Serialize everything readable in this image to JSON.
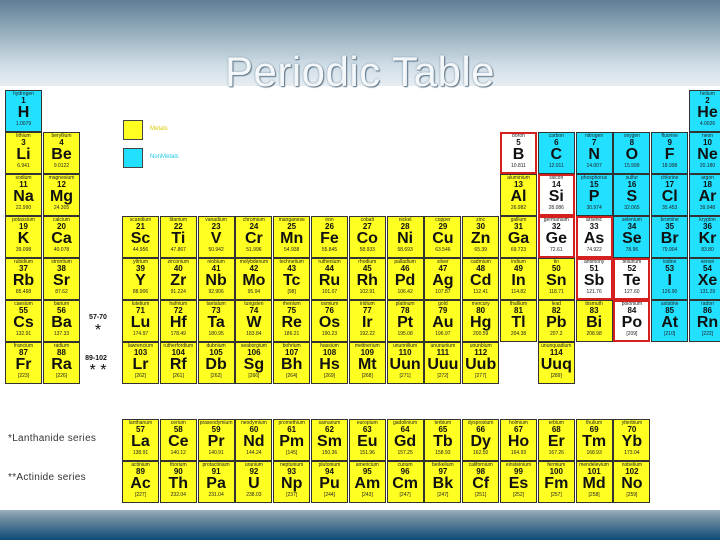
{
  "title": "Periodic Table",
  "legend": {
    "metals_label": "Metals",
    "nonmetals_label": "NonMetals",
    "metal_color": "#ffff22",
    "nonmetal_color": "#22e0ff"
  },
  "series": {
    "lanthanide_label": "*Lanthanide series",
    "actinide_label": "**Actinide series",
    "ref_57_70": "57-70",
    "ref_89_102": "89-102",
    "star_single": "*",
    "star_double": "* *"
  },
  "elements": [
    {
      "c": 1,
      "r": 1,
      "n": "hydrogen",
      "z": "1",
      "s": "H",
      "w": "1.0079",
      "k": "nonmetal"
    },
    {
      "c": 18,
      "r": 1,
      "n": "helium",
      "z": "2",
      "s": "He",
      "w": "4.0026",
      "k": "nonmetal"
    },
    {
      "c": 1,
      "r": 2,
      "n": "lithium",
      "z": "3",
      "s": "Li",
      "w": "6.941",
      "k": "metal"
    },
    {
      "c": 2,
      "r": 2,
      "n": "beryllium",
      "z": "4",
      "s": "Be",
      "w": "9.0122",
      "k": "metal"
    },
    {
      "c": 13,
      "r": 2,
      "n": "boron",
      "z": "5",
      "s": "B",
      "w": "10.811",
      "k": "plain",
      "h": true
    },
    {
      "c": 14,
      "r": 2,
      "n": "carbon",
      "z": "6",
      "s": "C",
      "w": "12.011",
      "k": "nonmetal"
    },
    {
      "c": 15,
      "r": 2,
      "n": "nitrogen",
      "z": "7",
      "s": "N",
      "w": "14.007",
      "k": "nonmetal"
    },
    {
      "c": 16,
      "r": 2,
      "n": "oxygen",
      "z": "8",
      "s": "O",
      "w": "15.999",
      "k": "nonmetal"
    },
    {
      "c": 17,
      "r": 2,
      "n": "fluorine",
      "z": "9",
      "s": "F",
      "w": "18.998",
      "k": "nonmetal"
    },
    {
      "c": 18,
      "r": 2,
      "n": "neon",
      "z": "10",
      "s": "Ne",
      "w": "20.180",
      "k": "nonmetal"
    },
    {
      "c": 1,
      "r": 3,
      "n": "sodium",
      "z": "11",
      "s": "Na",
      "w": "22.990",
      "k": "metal"
    },
    {
      "c": 2,
      "r": 3,
      "n": "magnesium",
      "z": "12",
      "s": "Mg",
      "w": "24.305",
      "k": "metal"
    },
    {
      "c": 13,
      "r": 3,
      "n": "aluminium",
      "z": "13",
      "s": "Al",
      "w": "26.982",
      "k": "metal"
    },
    {
      "c": 14,
      "r": 3,
      "n": "silicon",
      "z": "14",
      "s": "Si",
      "w": "28.086",
      "k": "plain",
      "h": true
    },
    {
      "c": 15,
      "r": 3,
      "n": "phosphorus",
      "z": "15",
      "s": "P",
      "w": "30.974",
      "k": "nonmetal"
    },
    {
      "c": 16,
      "r": 3,
      "n": "sulfur",
      "z": "16",
      "s": "S",
      "w": "32.065",
      "k": "nonmetal"
    },
    {
      "c": 17,
      "r": 3,
      "n": "chlorine",
      "z": "17",
      "s": "Cl",
      "w": "35.453",
      "k": "nonmetal"
    },
    {
      "c": 18,
      "r": 3,
      "n": "argon",
      "z": "18",
      "s": "Ar",
      "w": "39.948",
      "k": "nonmetal"
    },
    {
      "c": 1,
      "r": 4,
      "n": "potassium",
      "z": "19",
      "s": "K",
      "w": "39.098",
      "k": "metal"
    },
    {
      "c": 2,
      "r": 4,
      "n": "calcium",
      "z": "20",
      "s": "Ca",
      "w": "40.078",
      "k": "metal"
    },
    {
      "c": 3,
      "r": 4,
      "n": "scandium",
      "z": "21",
      "s": "Sc",
      "w": "44.956",
      "k": "metal"
    },
    {
      "c": 4,
      "r": 4,
      "n": "titanium",
      "z": "22",
      "s": "Ti",
      "w": "47.867",
      "k": "metal"
    },
    {
      "c": 5,
      "r": 4,
      "n": "vanadium",
      "z": "23",
      "s": "V",
      "w": "50.942",
      "k": "metal"
    },
    {
      "c": 6,
      "r": 4,
      "n": "chromium",
      "z": "24",
      "s": "Cr",
      "w": "51.996",
      "k": "metal"
    },
    {
      "c": 7,
      "r": 4,
      "n": "manganese",
      "z": "25",
      "s": "Mn",
      "w": "54.938",
      "k": "metal"
    },
    {
      "c": 8,
      "r": 4,
      "n": "iron",
      "z": "26",
      "s": "Fe",
      "w": "55.845",
      "k": "metal"
    },
    {
      "c": 9,
      "r": 4,
      "n": "cobalt",
      "z": "27",
      "s": "Co",
      "w": "58.933",
      "k": "metal"
    },
    {
      "c": 10,
      "r": 4,
      "n": "nickel",
      "z": "28",
      "s": "Ni",
      "w": "58.693",
      "k": "metal"
    },
    {
      "c": 11,
      "r": 4,
      "n": "copper",
      "z": "29",
      "s": "Cu",
      "w": "63.546",
      "k": "metal"
    },
    {
      "c": 12,
      "r": 4,
      "n": "zinc",
      "z": "30",
      "s": "Zn",
      "w": "65.39",
      "k": "metal"
    },
    {
      "c": 13,
      "r": 4,
      "n": "gallium",
      "z": "31",
      "s": "Ga",
      "w": "69.723",
      "k": "metal"
    },
    {
      "c": 14,
      "r": 4,
      "n": "germanium",
      "z": "32",
      "s": "Ge",
      "w": "72.61",
      "k": "plain",
      "h": true
    },
    {
      "c": 15,
      "r": 4,
      "n": "arsenic",
      "z": "33",
      "s": "As",
      "w": "74.922",
      "k": "plain",
      "h": true
    },
    {
      "c": 16,
      "r": 4,
      "n": "selenium",
      "z": "34",
      "s": "Se",
      "w": "78.96",
      "k": "nonmetal"
    },
    {
      "c": 17,
      "r": 4,
      "n": "bromine",
      "z": "35",
      "s": "Br",
      "w": "79.904",
      "k": "nonmetal"
    },
    {
      "c": 18,
      "r": 4,
      "n": "krypton",
      "z": "36",
      "s": "Kr",
      "w": "83.80",
      "k": "nonmetal"
    },
    {
      "c": 1,
      "r": 5,
      "n": "rubidium",
      "z": "37",
      "s": "Rb",
      "w": "85.468",
      "k": "metal"
    },
    {
      "c": 2,
      "r": 5,
      "n": "strontium",
      "z": "38",
      "s": "Sr",
      "w": "87.62",
      "k": "metal"
    },
    {
      "c": 3,
      "r": 5,
      "n": "yttrium",
      "z": "39",
      "s": "Y",
      "w": "88.906",
      "k": "metal"
    },
    {
      "c": 4,
      "r": 5,
      "n": "zirconium",
      "z": "40",
      "s": "Zr",
      "w": "91.224",
      "k": "metal"
    },
    {
      "c": 5,
      "r": 5,
      "n": "niobium",
      "z": "41",
      "s": "Nb",
      "w": "92.906",
      "k": "metal"
    },
    {
      "c": 6,
      "r": 5,
      "n": "molybdenum",
      "z": "42",
      "s": "Mo",
      "w": "95.94",
      "k": "metal"
    },
    {
      "c": 7,
      "r": 5,
      "n": "technetium",
      "z": "43",
      "s": "Tc",
      "w": "[98]",
      "k": "metal"
    },
    {
      "c": 8,
      "r": 5,
      "n": "ruthenium",
      "z": "44",
      "s": "Ru",
      "w": "101.07",
      "k": "metal"
    },
    {
      "c": 9,
      "r": 5,
      "n": "rhodium",
      "z": "45",
      "s": "Rh",
      "w": "102.91",
      "k": "metal"
    },
    {
      "c": 10,
      "r": 5,
      "n": "palladium",
      "z": "46",
      "s": "Pd",
      "w": "106.42",
      "k": "metal"
    },
    {
      "c": 11,
      "r": 5,
      "n": "silver",
      "z": "47",
      "s": "Ag",
      "w": "107.87",
      "k": "metal"
    },
    {
      "c": 12,
      "r": 5,
      "n": "cadmium",
      "z": "48",
      "s": "Cd",
      "w": "112.41",
      "k": "metal"
    },
    {
      "c": 13,
      "r": 5,
      "n": "indium",
      "z": "49",
      "s": "In",
      "w": "114.82",
      "k": "metal"
    },
    {
      "c": 14,
      "r": 5,
      "n": "tin",
      "z": "50",
      "s": "Sn",
      "w": "118.71",
      "k": "metal"
    },
    {
      "c": 15,
      "r": 5,
      "n": "antimony",
      "z": "51",
      "s": "Sb",
      "w": "121.76",
      "k": "plain",
      "h": true
    },
    {
      "c": 16,
      "r": 5,
      "n": "tellurium",
      "z": "52",
      "s": "Te",
      "w": "127.60",
      "k": "plain",
      "h": true
    },
    {
      "c": 17,
      "r": 5,
      "n": "iodine",
      "z": "53",
      "s": "I",
      "w": "126.90",
      "k": "nonmetal"
    },
    {
      "c": 18,
      "r": 5,
      "n": "xenon",
      "z": "54",
      "s": "Xe",
      "w": "131.29",
      "k": "nonmetal"
    },
    {
      "c": 1,
      "r": 6,
      "n": "caesium",
      "z": "55",
      "s": "Cs",
      "w": "132.91",
      "k": "metal"
    },
    {
      "c": 2,
      "r": 6,
      "n": "barium",
      "z": "56",
      "s": "Ba",
      "w": "137.33",
      "k": "metal"
    },
    {
      "c": 3,
      "r": 6,
      "n": "lutetium",
      "z": "71",
      "s": "Lu",
      "w": "174.97",
      "k": "metal"
    },
    {
      "c": 4,
      "r": 6,
      "n": "hafnium",
      "z": "72",
      "s": "Hf",
      "w": "178.49",
      "k": "metal"
    },
    {
      "c": 5,
      "r": 6,
      "n": "tantalum",
      "z": "73",
      "s": "Ta",
      "w": "180.95",
      "k": "metal"
    },
    {
      "c": 6,
      "r": 6,
      "n": "tungsten",
      "z": "74",
      "s": "W",
      "w": "183.84",
      "k": "metal"
    },
    {
      "c": 7,
      "r": 6,
      "n": "rhenium",
      "z": "75",
      "s": "Re",
      "w": "186.21",
      "k": "metal"
    },
    {
      "c": 8,
      "r": 6,
      "n": "osmium",
      "z": "76",
      "s": "Os",
      "w": "190.23",
      "k": "metal"
    },
    {
      "c": 9,
      "r": 6,
      "n": "iridium",
      "z": "77",
      "s": "Ir",
      "w": "192.22",
      "k": "metal"
    },
    {
      "c": 10,
      "r": 6,
      "n": "platinum",
      "z": "78",
      "s": "Pt",
      "w": "195.08",
      "k": "metal"
    },
    {
      "c": 11,
      "r": 6,
      "n": "gold",
      "z": "79",
      "s": "Au",
      "w": "196.97",
      "k": "metal"
    },
    {
      "c": 12,
      "r": 6,
      "n": "mercury",
      "z": "80",
      "s": "Hg",
      "w": "200.59",
      "k": "metal"
    },
    {
      "c": 13,
      "r": 6,
      "n": "thallium",
      "z": "81",
      "s": "Tl",
      "w": "204.38",
      "k": "metal"
    },
    {
      "c": 14,
      "r": 6,
      "n": "lead",
      "z": "82",
      "s": "Pb",
      "w": "207.2",
      "k": "metal"
    },
    {
      "c": 15,
      "r": 6,
      "n": "bismuth",
      "z": "83",
      "s": "Bi",
      "w": "208.98",
      "k": "metal"
    },
    {
      "c": 16,
      "r": 6,
      "n": "polonium",
      "z": "84",
      "s": "Po",
      "w": "[209]",
      "k": "plain",
      "h": true
    },
    {
      "c": 17,
      "r": 6,
      "n": "astatine",
      "z": "85",
      "s": "At",
      "w": "[210]",
      "k": "nonmetal"
    },
    {
      "c": 18,
      "r": 6,
      "n": "radon",
      "z": "86",
      "s": "Rn",
      "w": "[222]",
      "k": "nonmetal"
    },
    {
      "c": 1,
      "r": 7,
      "n": "francium",
      "z": "87",
      "s": "Fr",
      "w": "[223]",
      "k": "metal"
    },
    {
      "c": 2,
      "r": 7,
      "n": "radium",
      "z": "88",
      "s": "Ra",
      "w": "[226]",
      "k": "metal"
    },
    {
      "c": 3,
      "r": 7,
      "n": "lawrencium",
      "z": "103",
      "s": "Lr",
      "w": "[262]",
      "k": "metal"
    },
    {
      "c": 4,
      "r": 7,
      "n": "rutherfordium",
      "z": "104",
      "s": "Rf",
      "w": "[261]",
      "k": "metal"
    },
    {
      "c": 5,
      "r": 7,
      "n": "dubnium",
      "z": "105",
      "s": "Db",
      "w": "[262]",
      "k": "metal"
    },
    {
      "c": 6,
      "r": 7,
      "n": "seaborgium",
      "z": "106",
      "s": "Sg",
      "w": "[266]",
      "k": "metal"
    },
    {
      "c": 7,
      "r": 7,
      "n": "bohrium",
      "z": "107",
      "s": "Bh",
      "w": "[264]",
      "k": "metal"
    },
    {
      "c": 8,
      "r": 7,
      "n": "hassium",
      "z": "108",
      "s": "Hs",
      "w": "[269]",
      "k": "metal"
    },
    {
      "c": 9,
      "r": 7,
      "n": "meitnerium",
      "z": "109",
      "s": "Mt",
      "w": "[268]",
      "k": "metal"
    },
    {
      "c": 10,
      "r": 7,
      "n": "ununnilium",
      "z": "110",
      "s": "Uun",
      "w": "[271]",
      "k": "metal"
    },
    {
      "c": 11,
      "r": 7,
      "n": "unununium",
      "z": "111",
      "s": "Uuu",
      "w": "[272]",
      "k": "metal"
    },
    {
      "c": 12,
      "r": 7,
      "n": "ununbium",
      "z": "112",
      "s": "Uub",
      "w": "[277]",
      "k": "metal"
    },
    {
      "c": 14,
      "r": 7,
      "n": "ununquadium",
      "z": "114",
      "s": "Uuq",
      "w": "[289]",
      "k": "metal"
    },
    {
      "c": 3,
      "r": 9,
      "n": "lanthanum",
      "z": "57",
      "s": "La",
      "w": "138.91",
      "k": "metal"
    },
    {
      "c": 4,
      "r": 9,
      "n": "cerium",
      "z": "58",
      "s": "Ce",
      "w": "140.12",
      "k": "metal"
    },
    {
      "c": 5,
      "r": 9,
      "n": "praseodymium",
      "z": "59",
      "s": "Pr",
      "w": "140.91",
      "k": "metal"
    },
    {
      "c": 6,
      "r": 9,
      "n": "neodymium",
      "z": "60",
      "s": "Nd",
      "w": "144.24",
      "k": "metal"
    },
    {
      "c": 7,
      "r": 9,
      "n": "promethium",
      "z": "61",
      "s": "Pm",
      "w": "[145]",
      "k": "metal"
    },
    {
      "c": 8,
      "r": 9,
      "n": "samarium",
      "z": "62",
      "s": "Sm",
      "w": "150.36",
      "k": "metal"
    },
    {
      "c": 9,
      "r": 9,
      "n": "europium",
      "z": "63",
      "s": "Eu",
      "w": "151.96",
      "k": "metal"
    },
    {
      "c": 10,
      "r": 9,
      "n": "gadolinium",
      "z": "64",
      "s": "Gd",
      "w": "157.25",
      "k": "metal"
    },
    {
      "c": 11,
      "r": 9,
      "n": "terbium",
      "z": "65",
      "s": "Tb",
      "w": "158.93",
      "k": "metal"
    },
    {
      "c": 12,
      "r": 9,
      "n": "dysprosium",
      "z": "66",
      "s": "Dy",
      "w": "162.50",
      "k": "metal"
    },
    {
      "c": 13,
      "r": 9,
      "n": "holmium",
      "z": "67",
      "s": "Ho",
      "w": "164.93",
      "k": "metal"
    },
    {
      "c": 14,
      "r": 9,
      "n": "erbium",
      "z": "68",
      "s": "Er",
      "w": "167.26",
      "k": "metal"
    },
    {
      "c": 15,
      "r": 9,
      "n": "thulium",
      "z": "69",
      "s": "Tm",
      "w": "168.93",
      "k": "metal"
    },
    {
      "c": 16,
      "r": 9,
      "n": "ytterbium",
      "z": "70",
      "s": "Yb",
      "w": "173.04",
      "k": "metal"
    },
    {
      "c": 3,
      "r": 10,
      "n": "actinium",
      "z": "89",
      "s": "Ac",
      "w": "[227]",
      "k": "metal"
    },
    {
      "c": 4,
      "r": 10,
      "n": "thorium",
      "z": "90",
      "s": "Th",
      "w": "232.04",
      "k": "metal"
    },
    {
      "c": 5,
      "r": 10,
      "n": "protactinium",
      "z": "91",
      "s": "Pa",
      "w": "231.04",
      "k": "metal"
    },
    {
      "c": 6,
      "r": 10,
      "n": "uranium",
      "z": "92",
      "s": "U",
      "w": "238.03",
      "k": "metal"
    },
    {
      "c": 7,
      "r": 10,
      "n": "neptunium",
      "z": "93",
      "s": "Np",
      "w": "[237]",
      "k": "metal"
    },
    {
      "c": 8,
      "r": 10,
      "n": "plutonium",
      "z": "94",
      "s": "Pu",
      "w": "[244]",
      "k": "metal"
    },
    {
      "c": 9,
      "r": 10,
      "n": "americium",
      "z": "95",
      "s": "Am",
      "w": "[243]",
      "k": "metal"
    },
    {
      "c": 10,
      "r": 10,
      "n": "curium",
      "z": "96",
      "s": "Cm",
      "w": "[247]",
      "k": "metal"
    },
    {
      "c": 11,
      "r": 10,
      "n": "berkelium",
      "z": "97",
      "s": "Bk",
      "w": "[247]",
      "k": "metal"
    },
    {
      "c": 12,
      "r": 10,
      "n": "californium",
      "z": "98",
      "s": "Cf",
      "w": "[251]",
      "k": "metal"
    },
    {
      "c": 13,
      "r": 10,
      "n": "einsteinium",
      "z": "99",
      "s": "Es",
      "w": "[252]",
      "k": "metal"
    },
    {
      "c": 14,
      "r": 10,
      "n": "fermium",
      "z": "100",
      "s": "Fm",
      "w": "[257]",
      "k": "metal"
    },
    {
      "c": 15,
      "r": 10,
      "n": "mendelevium",
      "z": "101",
      "s": "Md",
      "w": "[258]",
      "k": "metal"
    },
    {
      "c": 16,
      "r": 10,
      "n": "nobelium",
      "z": "102",
      "s": "No",
      "w": "[259]",
      "k": "metal"
    }
  ]
}
